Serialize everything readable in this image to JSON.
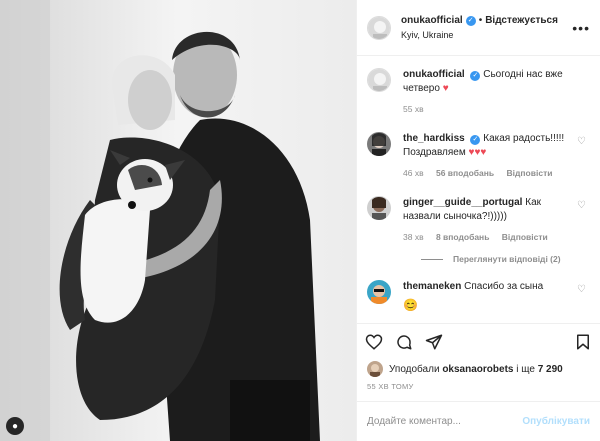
{
  "post": {
    "username": "onukaofficial",
    "follow_status": "Відстежується",
    "dot": "•",
    "location": "Kyiv, Ukraine",
    "more_icon": "ellipsis-icon",
    "verified_glyph": "✓"
  },
  "caption": {
    "username": "onukaofficial",
    "text": "Сьогодні нас вже четверо",
    "emoji": "♥",
    "time": "55 хв"
  },
  "comments": [
    {
      "username": "the_hardkiss",
      "verified": true,
      "text": "Какая радость!!!!! Поздравляем",
      "emoji": "♥♥♥",
      "time": "46 хв",
      "likes": "56 вподобань",
      "reply": "Відповісти"
    },
    {
      "username": "ginger__guide__portugal",
      "verified": false,
      "text": "Как назвали сыночка?!)))))",
      "time": "38 хв",
      "likes": "8 вподобань",
      "reply": "Відповісти",
      "view_replies": "Переглянути відповіді (2)"
    },
    {
      "username": "themaneken",
      "verified": false,
      "text": "Спасибо за сына",
      "emoji": "😊"
    }
  ],
  "likes": {
    "prefix": "Уподобали",
    "user": "oksanaorobets",
    "middle": "і ще",
    "count": "7 290"
  },
  "time_ago": "55 ХВ ТОМУ",
  "add_comment": {
    "placeholder": "Додайте коментар...",
    "post_label": "Опублікувати"
  },
  "colors": {
    "verified": "#3897f0",
    "heart": "#ed4956",
    "post_button": "#b2dffc",
    "muted": "#8e8e8e"
  }
}
